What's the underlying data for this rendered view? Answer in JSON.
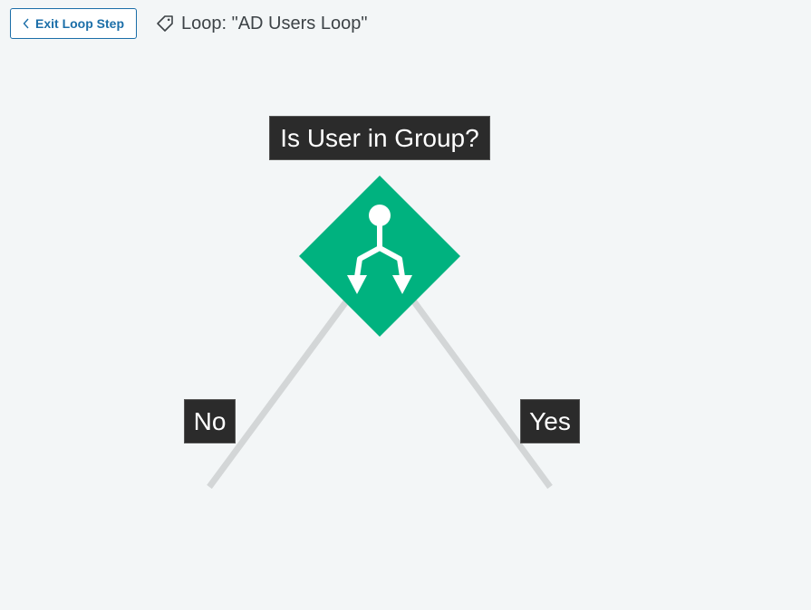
{
  "header": {
    "exit_button_label": "Exit Loop Step",
    "loop_title": "Loop: \"AD Users Loop\""
  },
  "icons": {
    "exit": "chevron-left-icon",
    "loop": "tag-icon",
    "node": "branch-split-icon"
  },
  "flow": {
    "decision_node": {
      "label": "Is User in Group?",
      "color": "#00b27f"
    },
    "branches": [
      {
        "label": "No"
      },
      {
        "label": "Yes"
      }
    ],
    "connector_color": "#d3d6d7"
  },
  "colors": {
    "background": "#f3f6f7",
    "accent": "#1b6ea8",
    "label_bg": "#2b2b2b"
  }
}
